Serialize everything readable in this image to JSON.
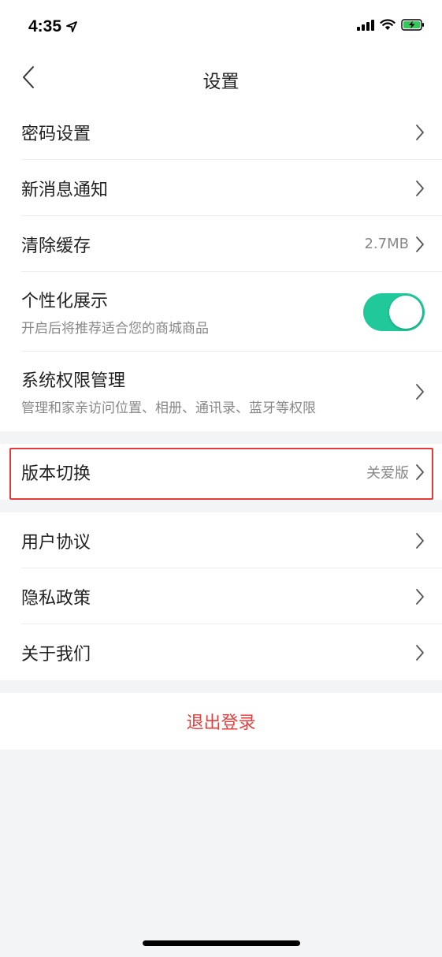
{
  "status_bar": {
    "time": "4:35"
  },
  "nav": {
    "title": "设置"
  },
  "group1": [
    {
      "label": "密码设置",
      "value": ""
    },
    {
      "label": "新消息通知",
      "value": ""
    },
    {
      "label": "清除缓存",
      "value": "2.7MB"
    }
  ],
  "personalized": {
    "label": "个性化展示",
    "sub": "开启后将推荐适合您的商城商品",
    "toggle_on": true
  },
  "permissions": {
    "label": "系统权限管理",
    "sub": "管理和家亲访问位置、相册、通讯录、蓝牙等权限"
  },
  "version": {
    "label": "版本切换",
    "value": "关爱版"
  },
  "group3": [
    {
      "label": "用户协议"
    },
    {
      "label": "隐私政策"
    },
    {
      "label": "关于我们"
    }
  ],
  "logout": {
    "label": "退出登录"
  },
  "colors": {
    "accent_toggle": "#21c89a",
    "danger": "#e63d3d",
    "highlight_border": "#e33a3a"
  }
}
